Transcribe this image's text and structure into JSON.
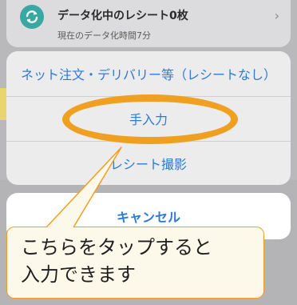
{
  "status_card": {
    "title": "データ化中のレシート0枚",
    "subtitle": "現在のデータ化時間7分",
    "chevron": "›",
    "icon": "sync-icon"
  },
  "action_sheet": {
    "options": [
      {
        "label": "ネット注文・デリバリー等（レシートなし）"
      },
      {
        "label": "手入力"
      },
      {
        "label": "レシート撮影"
      }
    ],
    "cancel_label": "キャンセル"
  },
  "annotation": {
    "line1": "こちらをタップすると",
    "line2": "入力できます"
  },
  "colors": {
    "accent": "#2f7ad6",
    "highlight": "#f0a020",
    "sync_icon": "#3aa8a2"
  }
}
